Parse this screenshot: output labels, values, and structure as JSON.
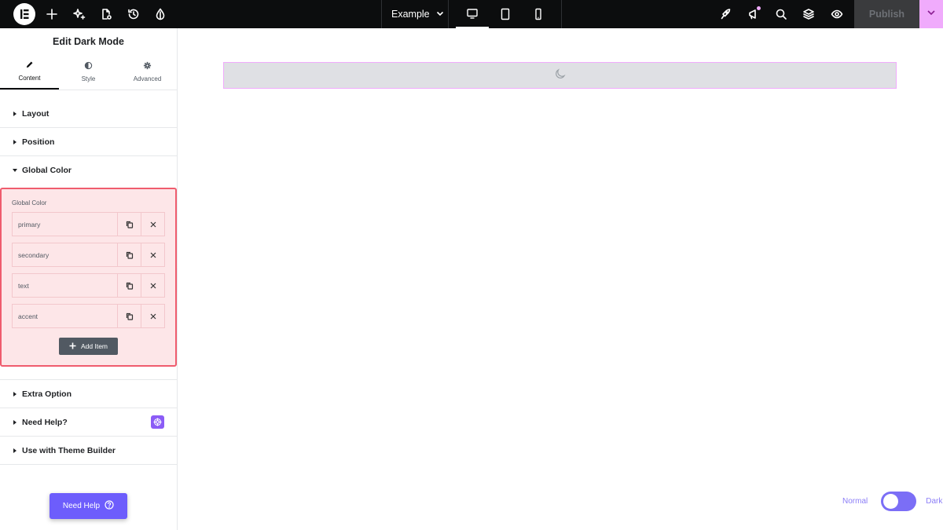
{
  "topbar": {
    "document_name": "Example",
    "publish_label": "Publish",
    "icons": [
      "elementor-logo-icon",
      "add-element-icon",
      "ai-sparkle-icon",
      "page-settings-icon",
      "history-icon",
      "site-settings-icon",
      "desktop-icon",
      "tablet-icon",
      "mobile-icon",
      "finder-rocket-icon",
      "announcements-icon",
      "search-icon",
      "structure-icon",
      "preview-eye-icon",
      "chevron-down-icon"
    ],
    "publish_arrow_color": "#f0abfc"
  },
  "panel": {
    "title": "Edit Dark Mode",
    "tabs": [
      {
        "label": "Content",
        "icon": "pencil-icon",
        "active": true
      },
      {
        "label": "Style",
        "icon": "half-circle-icon",
        "active": false
      },
      {
        "label": "Advanced",
        "icon": "gear-icon",
        "active": false
      }
    ],
    "sections": {
      "layout": "Layout",
      "position": "Position",
      "global_color": "Global Color",
      "extra_option": "Extra Option",
      "need_help": "Need Help?",
      "theme_builder": "Use with Theme Builder"
    },
    "global_color": {
      "field_label": "Global Color",
      "items": [
        "primary",
        "secondary",
        "text",
        "accent"
      ],
      "add_item_label": "Add Item"
    },
    "need_help_button": "Need Help"
  },
  "canvas": {
    "widget_icon": "moon-icon",
    "toggle": {
      "normal_label": "Normal",
      "dark_label": "Dark",
      "accent_color": "#7b6ef6"
    }
  }
}
